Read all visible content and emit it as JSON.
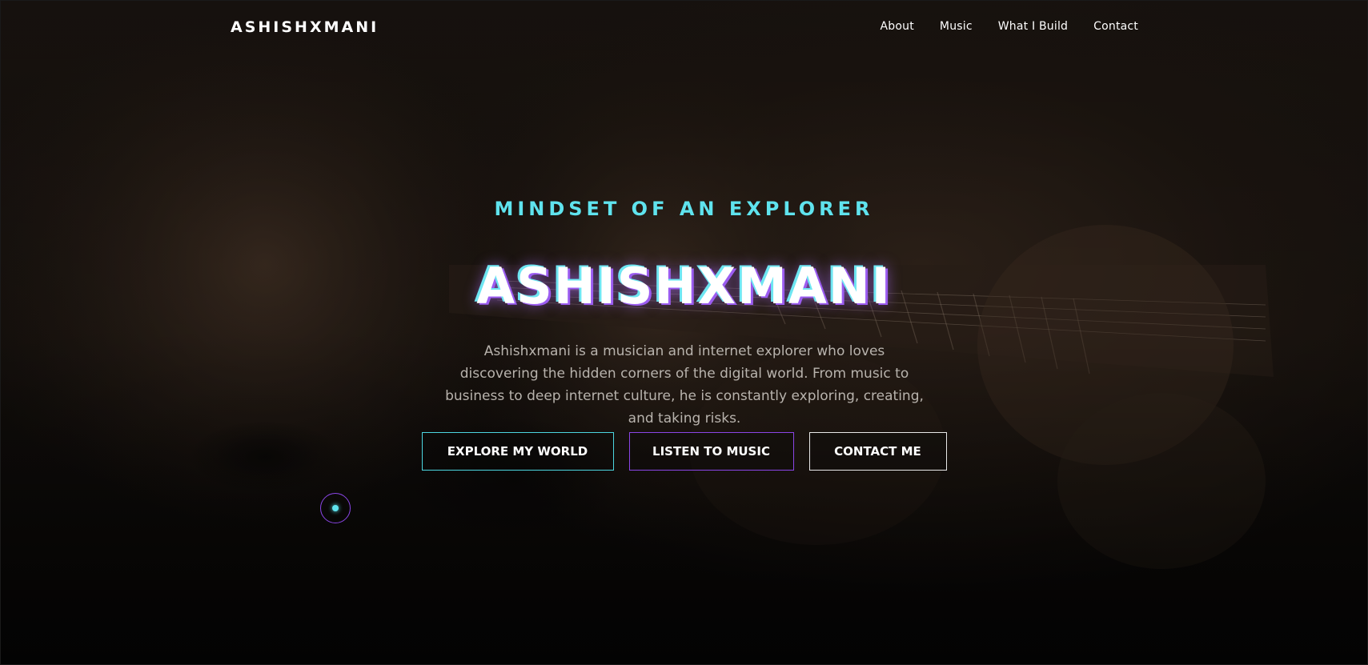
{
  "site": {
    "logo": "ASHISHXMANI"
  },
  "nav": {
    "links": [
      "About",
      "Music",
      "What I Build",
      "Contact"
    ]
  },
  "hero": {
    "tagline": "MINDSET OF AN EXPLORER",
    "title": "ASHISHXMANI",
    "description": "Ashishxmani is a musician and internet explorer who loves discovering the hidden corners of the digital world. From music to business to deep internet culture, he is constantly exploring, creating, and taking risks.",
    "buttons": {
      "explore": "EXPLORE MY WORLD",
      "listen": "LISTEN TO MUSIC",
      "contact": "CONTACT ME"
    }
  },
  "colors": {
    "accent_cyan": "#5fe3ee",
    "accent_purple": "#8a45e6",
    "background": "#0b0908"
  }
}
